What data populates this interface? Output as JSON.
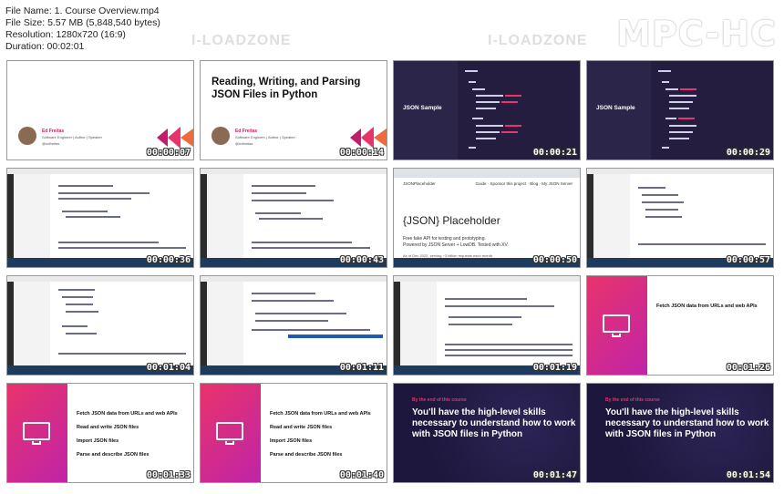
{
  "file_info": {
    "name": "File Name: 1. Course Overview.mp4",
    "size": "File Size: 5.57 MB (5,848,540 bytes)",
    "resolution": "Resolution: 1280x720 (16:9)",
    "duration": "Duration: 00:02:01"
  },
  "logo": "MPC-HC",
  "watermark": "I-LOADZONE",
  "thumbnails": [
    {
      "ts": "00:00:07",
      "type": "title",
      "title": ""
    },
    {
      "ts": "00:00:14",
      "type": "title",
      "title": "Reading, Writing, and Parsing JSON Files in Python"
    },
    {
      "ts": "00:00:21",
      "type": "json",
      "label": "JSON Sample"
    },
    {
      "ts": "00:00:29",
      "type": "json",
      "label": "JSON Sample"
    },
    {
      "ts": "00:00:36",
      "type": "vscode"
    },
    {
      "ts": "00:00:43",
      "type": "vscode"
    },
    {
      "ts": "00:00:50",
      "type": "browser",
      "title": "{JSON} Placeholder"
    },
    {
      "ts": "00:00:57",
      "type": "vscode"
    },
    {
      "ts": "00:01:04",
      "type": "vscode"
    },
    {
      "ts": "00:01:11",
      "type": "vscode"
    },
    {
      "ts": "00:01:19",
      "type": "vscode"
    },
    {
      "ts": "00:01:26",
      "type": "fetch",
      "items": [
        "Fetch JSON data from URLs and web APIs"
      ]
    },
    {
      "ts": "00:01:33",
      "type": "fetch",
      "items": [
        "Fetch JSON data from URLs and web APIs",
        "Read and write JSON files",
        "Import JSON files",
        "Parse and describe JSON files"
      ]
    },
    {
      "ts": "00:01:40",
      "type": "fetch",
      "items": [
        "Fetch JSON data from URLs and web APIs",
        "Read and write JSON files",
        "Import JSON files",
        "Parse and describe JSON files"
      ]
    },
    {
      "ts": "00:01:47",
      "type": "end",
      "kicker": "By the end of this course",
      "text": "You'll have the high-level skills necessary to understand how to work with JSON files in Python"
    },
    {
      "ts": "00:01:54",
      "type": "end",
      "kicker": "By the end of this course",
      "text": "You'll have the high-level skills necessary to understand how to work with JSON files in Python"
    }
  ],
  "speaker": {
    "name": "Ed Freitas",
    "role": "Software Engineer | Author | Speaker",
    "handle": "@edfreitas"
  },
  "colors": {
    "accent": "#e8336b",
    "dark": "#2b2549",
    "vscode_activity": "#2c2c2c"
  }
}
